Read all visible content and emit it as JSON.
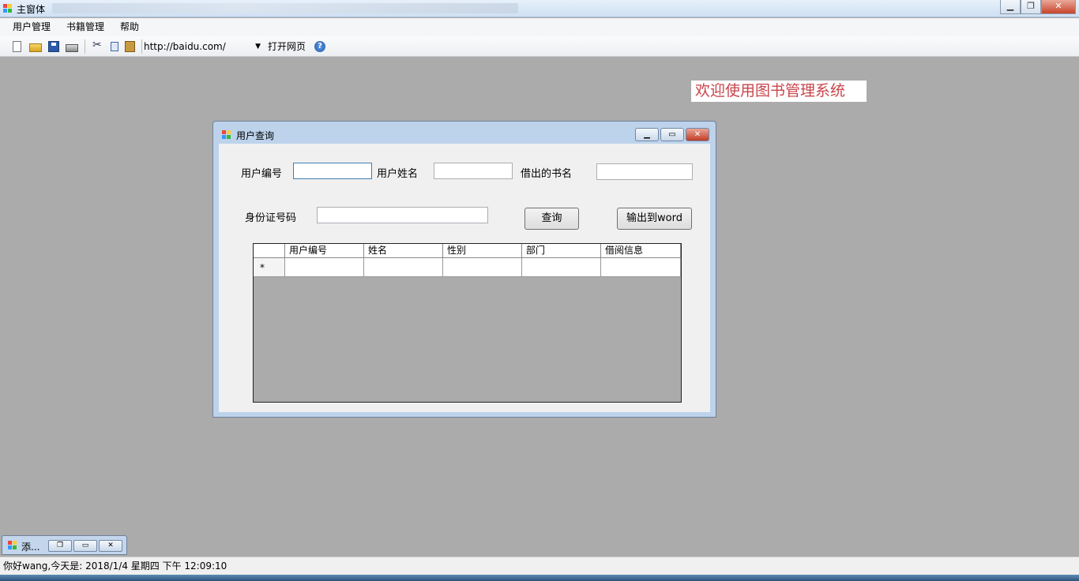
{
  "window": {
    "title": "主窗体"
  },
  "menu": {
    "items": [
      "用户管理",
      "书籍管理",
      "帮助"
    ]
  },
  "toolbar": {
    "url_value": "http://baidu.com/",
    "open_label": "打开网页",
    "help_glyph": "?",
    "icons": [
      "new-icon",
      "open-icon",
      "save-icon",
      "print-icon",
      "cut-icon",
      "copy-icon",
      "paste-icon",
      "help-icon"
    ]
  },
  "banner": {
    "text": "欢迎使用图书管理系统",
    "color": "#c8444a"
  },
  "child_window": {
    "title": "用户查询",
    "labels": {
      "user_id": "用户编号",
      "user_name": "用户姓名",
      "book_name": "借出的书名",
      "id_card": "身份证号码"
    },
    "inputs": {
      "user_id": "",
      "user_name": "",
      "book_name": "",
      "id_card": ""
    },
    "buttons": {
      "query": "查询",
      "export": "输出到word"
    },
    "grid": {
      "columns": [
        "用户编号",
        "姓名",
        "性别",
        "部门",
        "借阅信息"
      ],
      "new_row_marker": "*"
    }
  },
  "minimized_window": {
    "title": "添..."
  },
  "status": {
    "text": "你好wang,今天是:  2018/1/4 星期四 下午 12:09:10"
  }
}
